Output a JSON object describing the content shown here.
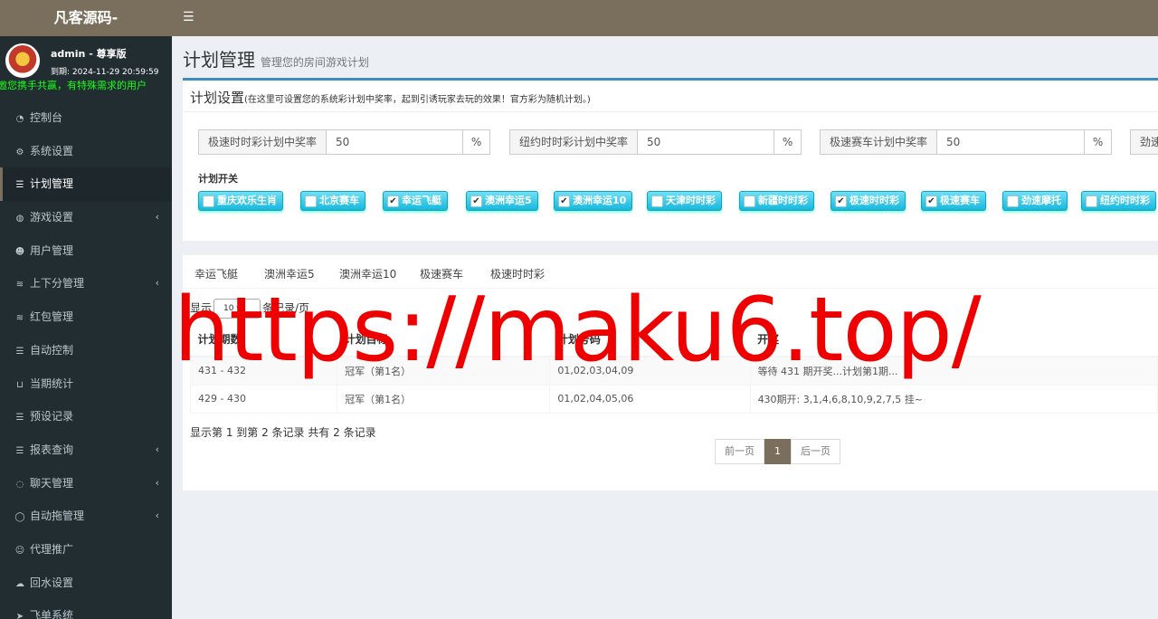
{
  "brand": "凡客源码-",
  "user": {
    "name": "admin - 尊享版",
    "expiry": "到期: 2024-11-29 20:59:59"
  },
  "marquee": "诚邀您携手共赢，有特殊需求的用户",
  "menu": [
    {
      "label": "控制台",
      "icon": "dashboard-icon"
    },
    {
      "label": "系统设置",
      "icon": "gears-icon"
    },
    {
      "label": "计划管理",
      "icon": "list-icon",
      "active": true
    },
    {
      "label": "游戏设置",
      "icon": "gamepad-icon",
      "arrow": true
    },
    {
      "label": "用户管理",
      "icon": "users-icon"
    },
    {
      "label": "上下分管理",
      "icon": "database-icon",
      "arrow": true
    },
    {
      "label": "红包管理",
      "icon": "database-icon"
    },
    {
      "label": "自动控制",
      "icon": "list-icon"
    },
    {
      "label": "当期统计",
      "icon": "cart-icon"
    },
    {
      "label": "预设记录",
      "icon": "list-icon"
    },
    {
      "label": "报表查询",
      "icon": "list-icon",
      "arrow": true
    },
    {
      "label": "聊天管理",
      "icon": "chat-icon",
      "arrow": true
    },
    {
      "label": "自动拖管理",
      "icon": "comment-icon",
      "arrow": true
    },
    {
      "label": "代理推广",
      "icon": "user-plus-icon"
    },
    {
      "label": "回水设置",
      "icon": "cloud-upload-icon"
    },
    {
      "label": "飞单系统",
      "icon": "paper-plane-icon"
    }
  ],
  "page": {
    "title": "计划管理",
    "subtitle": "管理您的房间游戏计划"
  },
  "settings": {
    "title": "计划设置",
    "hint": "(在这里可设置您的系统彩计划中奖率，起到引诱玩家去玩的效果！官方彩为随机计划。)",
    "rates": [
      {
        "label": "极速时时彩计划中奖率",
        "value": "50",
        "unit": "%"
      },
      {
        "label": "纽约时时彩计划中奖率",
        "value": "50",
        "unit": "%"
      },
      {
        "label": "极速赛车计划中奖率",
        "value": "50",
        "unit": "%"
      },
      {
        "label": "劲速"
      }
    ],
    "switch_title": "计划开关",
    "switches": [
      {
        "label": "重庆欢乐生肖",
        "checked": false
      },
      {
        "label": "北京赛车",
        "checked": false
      },
      {
        "label": "幸运飞艇",
        "checked": true
      },
      {
        "label": "澳洲幸运5",
        "checked": true
      },
      {
        "label": "澳洲幸运10",
        "checked": true
      },
      {
        "label": "天津时时彩",
        "checked": false
      },
      {
        "label": "新疆时时彩",
        "checked": false
      },
      {
        "label": "极速时时彩",
        "checked": true
      },
      {
        "label": "极速赛车",
        "checked": true
      },
      {
        "label": "劲速摩托",
        "checked": false
      },
      {
        "label": "纽约时时彩",
        "checked": false
      }
    ],
    "check_mark": "✔"
  },
  "tabs": [
    "幸运飞艇",
    "澳洲幸运5",
    "澳洲幸运10",
    "极速赛车",
    "极速时时彩"
  ],
  "length": {
    "prefix": "显示",
    "value": "10",
    "suffix": "条记录/页"
  },
  "table": {
    "headers": [
      "计划期数",
      "计划目标",
      "计划号码",
      "开奖"
    ],
    "rows": [
      [
        "431 - 432",
        "冠军（第1名）",
        "01,02,03,04,09",
        "等待 431 期开奖...计划第1期..."
      ],
      [
        "429 - 430",
        "冠军（第1名）",
        "01,02,04,05,06",
        "430期开: 3,1,4,6,8,10,9,2,7,5 挂~"
      ]
    ]
  },
  "info": "显示第 1 到第 2 条记录 共有 2 条记录",
  "pager": {
    "prev": "前一页",
    "current": "1",
    "next": "后一页"
  },
  "watermark": "https://maku6.top/",
  "colors": {
    "accent": "#7a6f5c",
    "sidebar": "#222d32",
    "switch": "#19b7dc",
    "watermark": "#ee0000"
  }
}
